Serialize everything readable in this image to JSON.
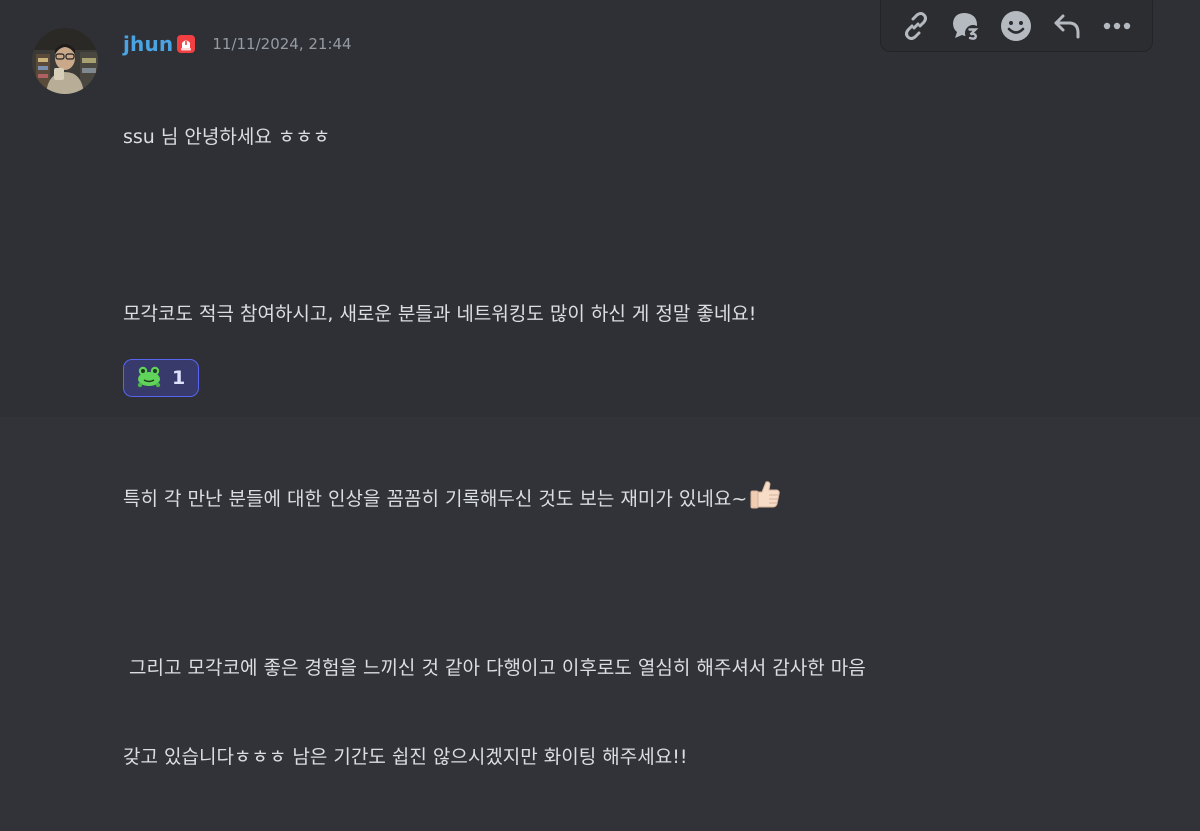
{
  "message": {
    "author": "jhun",
    "timestamp": "11/11/2024, 21:44",
    "lines": [
      "ssu 님 안녕하세요 ㅎㅎㅎ",
      "",
      "모각코도 적극 참여하시고, 새로운 분들과 네트워킹도 많이 하신 게 정말 좋네요!",
      "",
      "특히 각 만난 분들에 대한 인상을 꼼꼼히 기록해두신 것도 보는 재미가 있네요~",
      "",
      " 그리고 모각코에 좋은 경험을 느끼신 것 같아 다행이고 이후로도 열심히 해주셔서 감사한 마음",
      "갖고 있습니다ㅎㅎㅎ 남은 기간도 쉽진 않으시겠지만 화이팅 해주세요!!"
    ],
    "inline_emoji": "thumbs-up-icon"
  },
  "reaction": {
    "emoji": "frog-emoji",
    "count": "1"
  },
  "toolbar": {
    "icons": [
      "link-icon",
      "thread-reply-icon",
      "add-reaction-icon",
      "reply-icon",
      "more-icon"
    ]
  },
  "colors": {
    "username": "#4aa3e2",
    "background": "#2e3035",
    "reaction_border": "#5865f2",
    "reaction_bg": "#373a6b"
  }
}
